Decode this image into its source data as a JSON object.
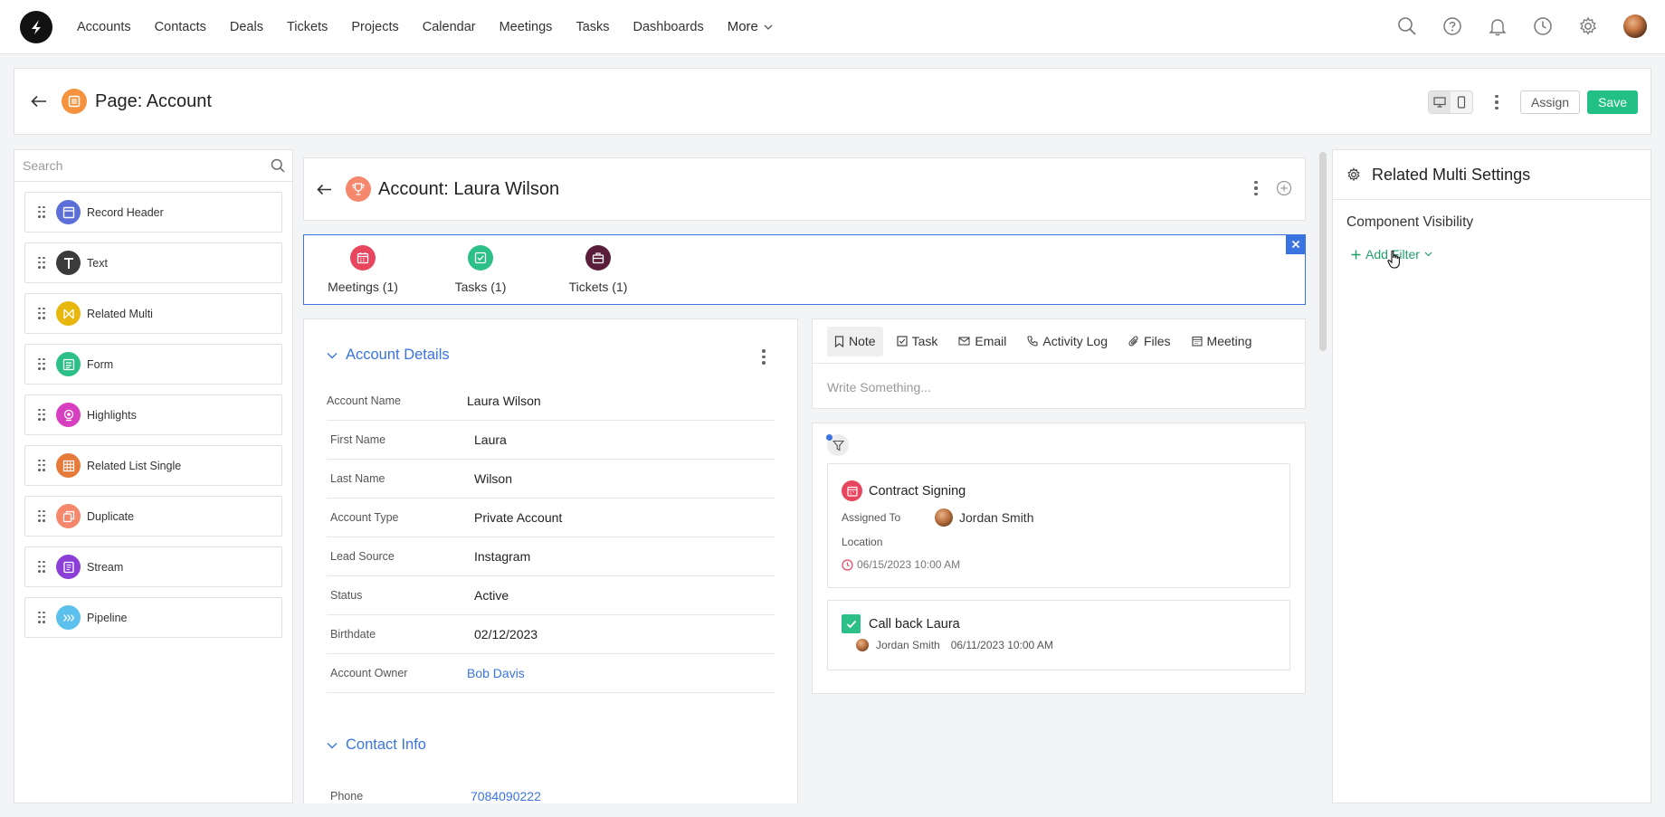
{
  "topnav": {
    "items": [
      "Accounts",
      "Contacts",
      "Deals",
      "Tickets",
      "Projects",
      "Calendar",
      "Meetings",
      "Tasks",
      "Dashboards"
    ],
    "more_label": "More",
    "icons": [
      "search-icon",
      "help-icon",
      "bell-icon",
      "clock-icon",
      "gear-icon"
    ]
  },
  "page_header": {
    "title": "Page: Account",
    "assign_label": "Assign",
    "save_label": "Save"
  },
  "left_panel": {
    "search_placeholder": "Search",
    "components": [
      {
        "label": "Record Header",
        "color": "#5b6fd6",
        "icon": "layout-icon"
      },
      {
        "label": "Text",
        "color": "#3b3b3b",
        "icon": "text-icon"
      },
      {
        "label": "Related Multi",
        "color": "#e8b70e",
        "icon": "related-multi-icon"
      },
      {
        "label": "Form",
        "color": "#2dbf88",
        "icon": "form-icon"
      },
      {
        "label": "Highlights",
        "color": "#d63fc0",
        "icon": "highlights-icon"
      },
      {
        "label": "Related List Single",
        "color": "#e57a3a",
        "icon": "grid-icon"
      },
      {
        "label": "Duplicate",
        "color": "#f4876c",
        "icon": "duplicate-icon"
      },
      {
        "label": "Stream",
        "color": "#8b3fd6",
        "icon": "stream-icon"
      },
      {
        "label": "Pipeline",
        "color": "#5bc0eb",
        "icon": "pipeline-icon"
      }
    ]
  },
  "record_header": {
    "title": "Account: Laura Wilson"
  },
  "related_multi": {
    "tabs": [
      {
        "label": "Meetings (1)",
        "color": "#e8455e"
      },
      {
        "label": "Tasks (1)",
        "color": "#2dbf88"
      },
      {
        "label": "Tickets (1)",
        "color": "#5a1e3a"
      }
    ]
  },
  "account_details": {
    "section_title": "Account Details",
    "fields": [
      {
        "label": "Account Name",
        "value": "Laura Wilson"
      },
      {
        "label": "First Name",
        "value": "Laura"
      },
      {
        "label": "Last Name",
        "value": "Wilson"
      },
      {
        "label": "Account Type",
        "value": "Private Account"
      },
      {
        "label": "Lead Source",
        "value": "Instagram"
      },
      {
        "label": "Status",
        "value": "Active"
      },
      {
        "label": "Birthdate",
        "value": "02/12/2023"
      },
      {
        "label": "Account Owner",
        "value": "Bob Davis"
      }
    ],
    "contact_section_title": "Contact Info",
    "contact_fields": [
      {
        "label": "Phone",
        "value": "7084090222"
      }
    ]
  },
  "activity": {
    "tabs": [
      "Note",
      "Task",
      "Email",
      "Activity Log",
      "Files",
      "Meeting"
    ],
    "write_placeholder": "Write Something..."
  },
  "stream": {
    "meeting": {
      "title": "Contract Signing",
      "assigned_label": "Assigned To",
      "assignee": "Jordan Smith",
      "location_label": "Location",
      "datetime": "06/15/2023 10:00 AM"
    },
    "task": {
      "title": "Call back Laura",
      "assignee": "Jordan Smith",
      "datetime": "06/11/2023 10:00 AM"
    }
  },
  "right_panel": {
    "title": "Related Multi Settings",
    "subtitle": "Component Visibility",
    "add_filter_label": "Add Filter"
  }
}
